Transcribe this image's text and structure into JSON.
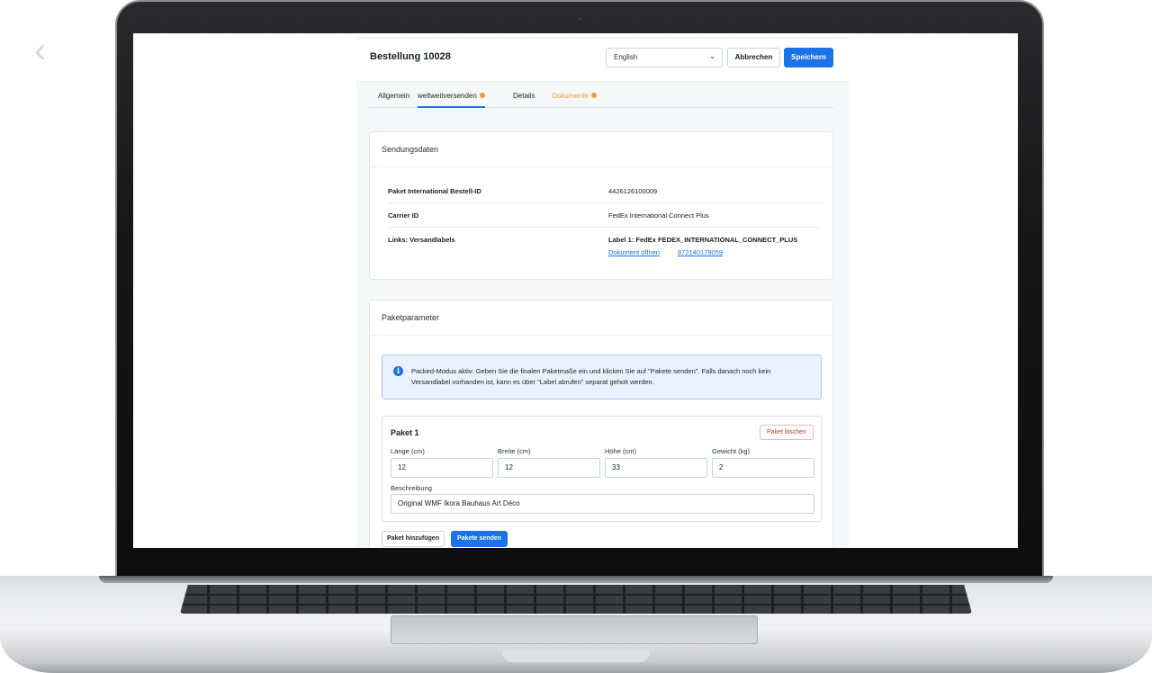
{
  "header": {
    "title": "Bestellung 10028",
    "language": "English",
    "cancel_label": "Abbrechen",
    "save_label": "Speichern"
  },
  "tabs": [
    {
      "label": "Allgemein",
      "active": false,
      "badge": false
    },
    {
      "label": "weltweitversenden",
      "active": true,
      "badge": true
    },
    {
      "label": "Details",
      "active": false,
      "badge": false
    },
    {
      "label": "Dokumente",
      "active": false,
      "badge": true
    }
  ],
  "shipment": {
    "title": "Sendungsdaten",
    "rows": [
      {
        "key": "Paket International Bestell-ID",
        "value": "4426126100009"
      },
      {
        "key": "Carrier ID",
        "value": "FedEx International Connect Plus"
      },
      {
        "key": "Links: Versandlabels",
        "value": "Label 1: FedEx FEDEX_INTERNATIONAL_CONNECT_PLUS"
      }
    ],
    "links": {
      "open_document": "Dokument öffnen",
      "tracking": "872140179059"
    }
  },
  "packages": {
    "title": "Paketparameter",
    "info": "Packed-Modus aktiv: Geben Sie die finalen Paketmaße ein und klicken Sie auf \"Pakete senden\". Falls danach noch kein Versandlabel vorhanden ist, kann es über \"Label abrufen\" separat geholt werden.",
    "package": {
      "title": "Paket 1",
      "delete_label": "Paket löschen",
      "fields": {
        "length_label": "Länge (cm)",
        "length": "12",
        "width_label": "Breite (cm)",
        "width": "12",
        "height_label": "Höhe (cm)",
        "height": "33",
        "weight_label": "Gewicht (kg)",
        "weight": "2",
        "description_label": "Beschreibung",
        "description": "Original WMF Ikora Bauhaus Art Déco"
      }
    },
    "add_label": "Paket hinzufügen",
    "send_label": "Pakete senden"
  },
  "colors": {
    "accent": "#1a73e8",
    "warning": "#f39c34",
    "danger": "#c0392b",
    "info_bg": "#e8f1fd"
  }
}
